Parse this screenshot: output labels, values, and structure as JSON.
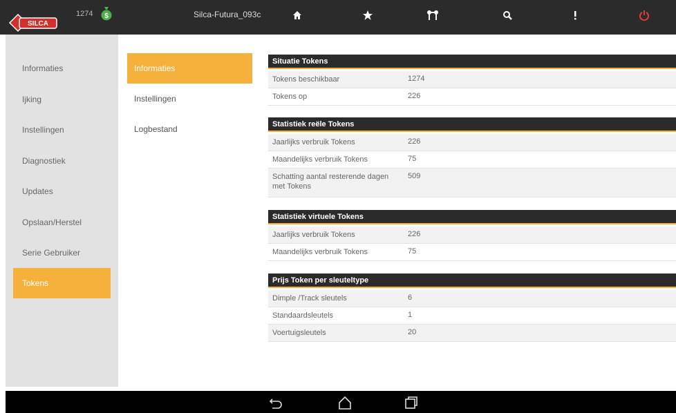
{
  "topbar": {
    "logo_text": "SILCA",
    "token_count": "1274",
    "device_name": "Silca-Futura_093c",
    "icons": [
      "home-icon",
      "star-icon",
      "keys-icon",
      "search-icon",
      "more-icon",
      "power-icon"
    ],
    "colors": {
      "bar": "#2b2b2b",
      "money": "#4caf50",
      "power": "#e53935",
      "logo": "#d32f2f"
    }
  },
  "leftnav": {
    "items": [
      {
        "label": "Informaties"
      },
      {
        "label": "Ijking"
      },
      {
        "label": "Instellingen"
      },
      {
        "label": "Diagnostiek"
      },
      {
        "label": "Updates"
      },
      {
        "label": "Opslaan/Herstel"
      },
      {
        "label": "Serie Gebruiker"
      },
      {
        "label": "Tokens"
      }
    ],
    "active": "Tokens"
  },
  "subnav": {
    "items": [
      {
        "label": "Informaties"
      },
      {
        "label": "Instellingen"
      },
      {
        "label": "Logbestand"
      }
    ],
    "active": "Informaties"
  },
  "sections": [
    {
      "title": "Situatie Tokens",
      "rows": [
        {
          "label": "Tokens beschikbaar",
          "value": "1274"
        },
        {
          "label": "Tokens op",
          "value": "226"
        }
      ]
    },
    {
      "title": "Statistiek reële Tokens",
      "rows": [
        {
          "label": "Jaarlijks verbruik Tokens",
          "value": "226"
        },
        {
          "label": "Maandelijks verbruik Tokens",
          "value": "75"
        },
        {
          "label": "Schatting aantal resterende dagen met Tokens",
          "value": "509"
        }
      ]
    },
    {
      "title": "Statistiek virtuele Tokens",
      "rows": [
        {
          "label": "Jaarlijks verbruik Tokens",
          "value": "226"
        },
        {
          "label": "Maandelijks verbruik Tokens",
          "value": "75"
        }
      ]
    },
    {
      "title": "Prijs Token per sleuteltype",
      "rows": [
        {
          "label": "Dimple /Track sleutels",
          "value": "6"
        },
        {
          "label": "Standaardsleutels",
          "value": "1"
        },
        {
          "label": "Voertuigsleutels",
          "value": "20"
        }
      ]
    }
  ],
  "navbar": {
    "icons": [
      "back-icon",
      "home-icon",
      "recents-icon"
    ]
  },
  "accent_color": "#f6b13d"
}
